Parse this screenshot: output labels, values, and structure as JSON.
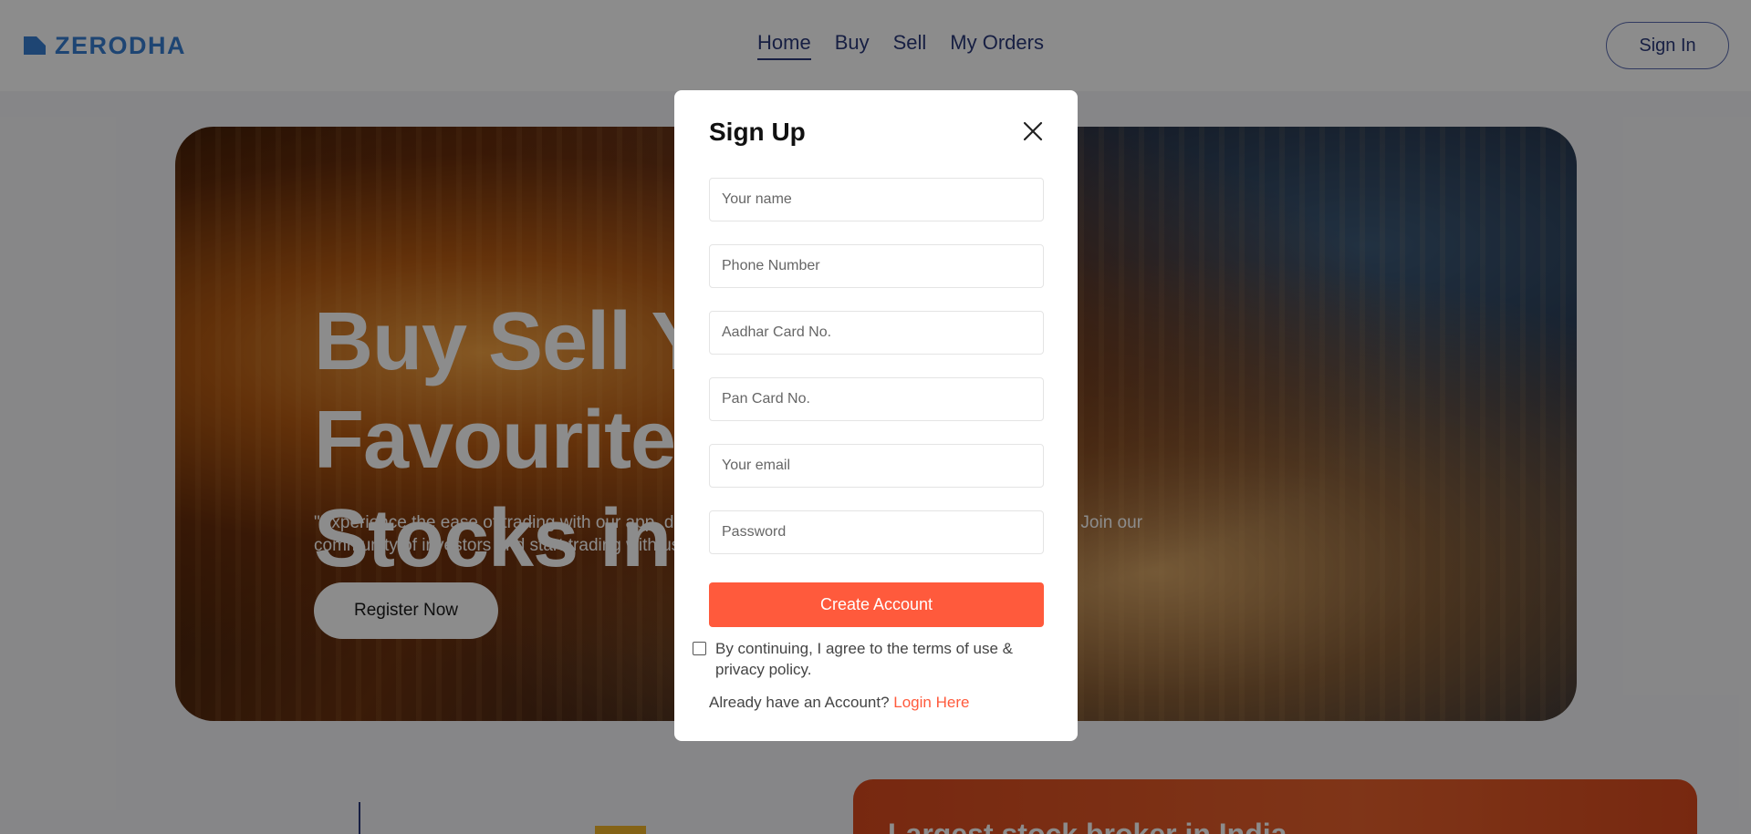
{
  "brand": {
    "name": "ZERODHA",
    "color": "#387ed1"
  },
  "nav": {
    "items": [
      {
        "label": "Home",
        "active": true
      },
      {
        "label": "Buy",
        "active": false
      },
      {
        "label": "Sell",
        "active": false
      },
      {
        "label": "My Orders",
        "active": false
      }
    ],
    "signin_label": "Sign In"
  },
  "hero": {
    "title_line1": "Buy Sell Your Favourite",
    "title_line2": "Stocks in Seconds",
    "subtitle": "\"Experience the ease of trading with our app, designed to help you buy and sell stocks effortlessly. . Join our community of investors and start trading with us today.\"",
    "register_label": "Register Now"
  },
  "below": {
    "card_title": "Largest stock broker in India"
  },
  "modal": {
    "title": "Sign Up",
    "close_icon": "close-icon",
    "fields": {
      "name": "Your name",
      "phone": "Phone Number",
      "aadhar": "Aadhar Card No.",
      "pan": "Pan Card No.",
      "email": "Your email",
      "password": "Password"
    },
    "create_label": "Create Account",
    "agree_text": "By continuing, I agree to the terms of use & privacy policy.",
    "login_prompt": "Already have an Account?",
    "login_link": "Login Here"
  },
  "colors": {
    "accent": "#ff5a3c",
    "nav_text": "#2b3a7a",
    "overlay": "rgba(0,0,0,0.45)"
  }
}
